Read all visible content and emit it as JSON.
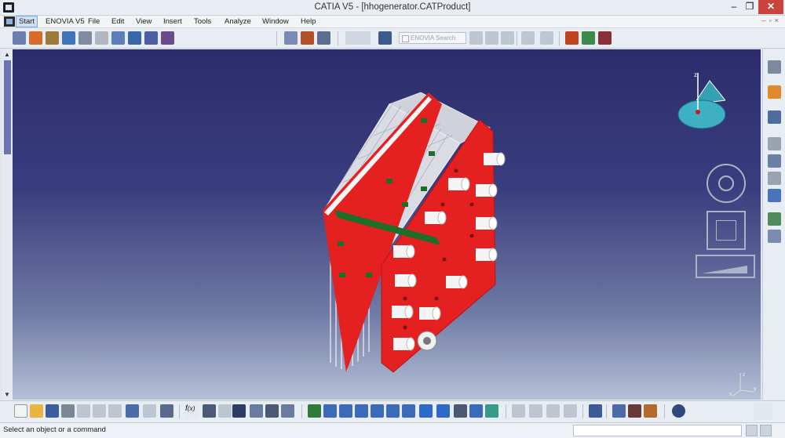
{
  "window": {
    "title": "CATIA V5 - [hhogenerator.CATProduct]",
    "min_label": "–",
    "max_label": "❐",
    "close_label": "✕"
  },
  "menu": {
    "items": [
      "Start",
      "ENOVIA V5",
      "File",
      "Edit",
      "View",
      "Insert",
      "Tools",
      "Analyze",
      "Window",
      "Help"
    ]
  },
  "toolbar_top": {
    "enovia_search_placeholder": "ENOVIA Search"
  },
  "compass": {
    "label": "z"
  },
  "axis_widget": {
    "x": "x",
    "y": "y",
    "z": "z"
  },
  "status": {
    "message": "Select an object or a command",
    "command_input": ""
  },
  "colors": {
    "viewport_top": "#2c2c6c",
    "viewport_bottom": "#b4c0d6",
    "part_red": "#e52020",
    "stud_white": "#f4f4f4",
    "mesh_white": "#dcdcdc",
    "green_marker": "#1e6e28",
    "compass_teal": "#33a0b4"
  }
}
